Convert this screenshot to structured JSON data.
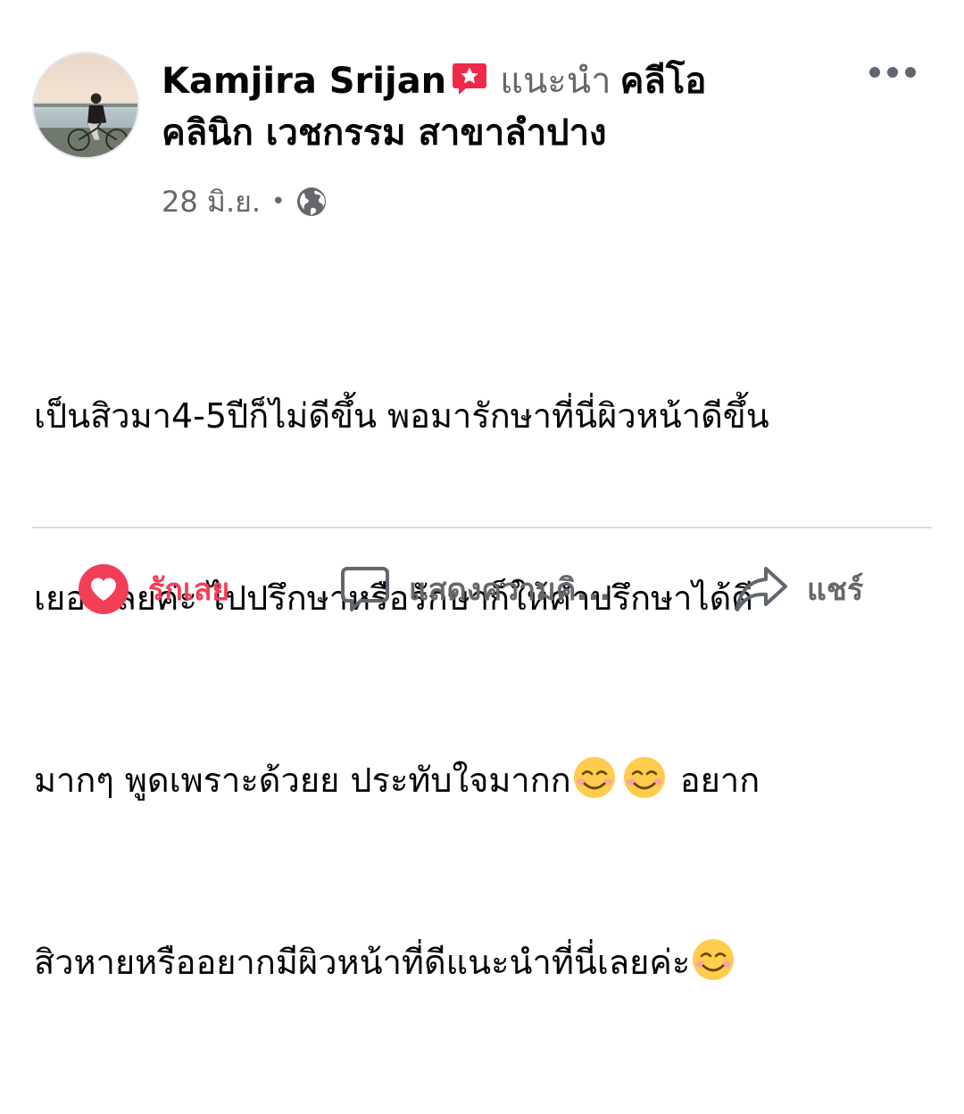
{
  "post": {
    "author": "Kamjira Srijan",
    "recommends_label": "แนะนำ",
    "page_name_part1": "คลีโอ",
    "page_name_part2": "คลินิก เวชกรรม สาขาลำปาง",
    "date": "28 มิ.ย.",
    "separator": "•",
    "privacy_icon": "globe-icon",
    "badge_icon": "recommend-star-icon",
    "body_lines": [
      "เป็นสิวมา4-5ปีก็ไม่ดีขึ้น พอมารักษาที่นี่ผิวหน้าดีขึ้น",
      "เยอะเลยค่ะ  ไปปรึกษาหรือรักษาก็ให้คำปรึกษาได้ดี",
      "มากๆ พูดเพราะด้วยย ประทับใจมากก",
      "อยาก",
      "สิวหายหรืออยากมีผิวหน้าที่ดีแนะนำที่นี่เลยค่ะ"
    ],
    "emoji": "smiling-face-emoji"
  },
  "actions": {
    "like_label": "รักเลย",
    "comment_label": "แสดงความคิ...",
    "share_label": "แชร์"
  },
  "colors": {
    "like_red": "#f33e58",
    "muted_gray": "#65676b",
    "badge_red": "#f02849",
    "text": "#050505"
  }
}
